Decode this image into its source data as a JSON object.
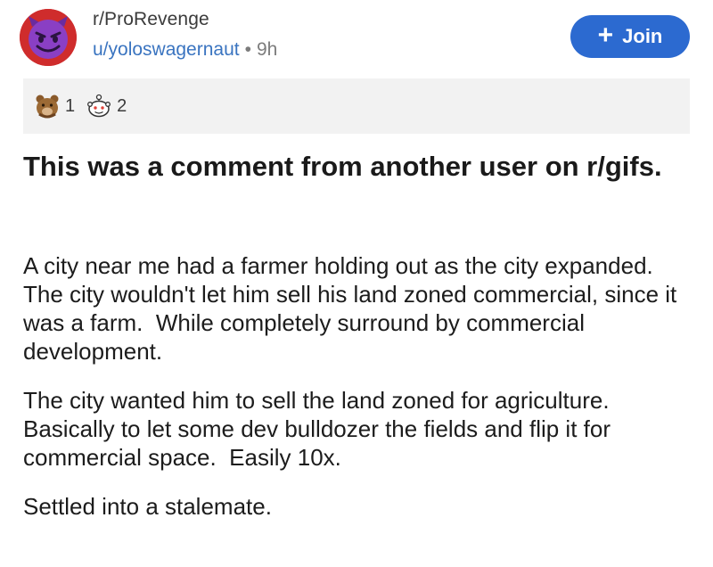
{
  "post": {
    "subreddit": "r/ProRevenge",
    "author": "u/yoloswagernaut",
    "separator": "•",
    "age": "9h",
    "join_label": "Join",
    "join_icon": "plus-icon",
    "awards": [
      {
        "icon": "wholesome-bear-award-icon",
        "count": "1"
      },
      {
        "icon": "silver-snoo-award-icon",
        "count": "2"
      }
    ],
    "title": "This was a comment from another user on r/gifs.",
    "paragraphs": [
      "A city near me had a farmer holding out as the city expanded.  The city wouldn't let him sell his land zoned commercial, since it was a farm.  While completely surround by commercial development.",
      "The city wanted him to sell the land zoned for agriculture.  Basically to let some dev bulldozer the fields and flip it for commercial space.  Easily 10x.",
      "Settled into a stalemate."
    ]
  },
  "colors": {
    "join_button": "#2c6ad0",
    "username_link": "#3a74c0",
    "avatar_ring": "#cf2c2c",
    "avatar_face": "#8a3fc4",
    "awards_bar_bg": "#f2f2f2"
  }
}
